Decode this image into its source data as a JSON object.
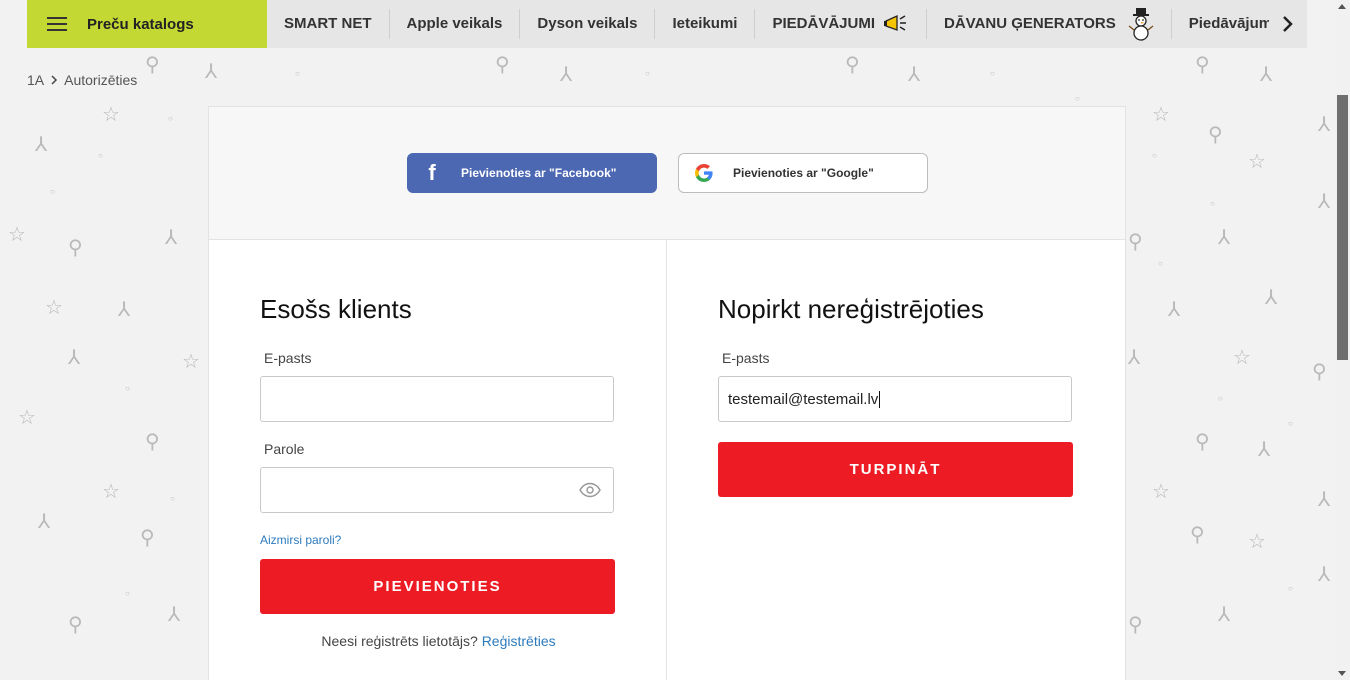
{
  "nav": {
    "catalog_label": "Preču katalogs",
    "items": [
      {
        "label": "SMART NET"
      },
      {
        "label": "Apple veikals"
      },
      {
        "label": "Dyson veikals"
      },
      {
        "label": "Ieteikumi"
      },
      {
        "label": "PIEDĀVĀJUMI"
      },
      {
        "label": "DĀVANU ĢENERATORS"
      },
      {
        "label": "Piedāvājums bi"
      }
    ]
  },
  "breadcrumb": {
    "home": "1A",
    "current": "Autorizēties"
  },
  "social": {
    "facebook_label": "Pievienoties ar \"Facebook\"",
    "google_label": "Pievienoties ar \"Google\"",
    "facebook_color": "#4c68b3"
  },
  "login": {
    "title": "Esošs klients",
    "email_label": "E-pasts",
    "email_value": "",
    "password_label": "Parole",
    "password_value": "",
    "forgot_link": "Aizmirsi paroli?",
    "submit_label": "PIEVIENOTIES",
    "register_prompt": "Neesi reģistrēts lietotājs?",
    "register_link": "Reģistrēties"
  },
  "guest": {
    "title": "Nopirkt nereģistrējoties",
    "email_label": "E-pasts",
    "email_value": "testemail@testemail.lv",
    "submit_label": "TURPINĀT"
  },
  "colors": {
    "accent_green": "#c3d833",
    "button_red": "#ed1c24",
    "link_blue": "#2d7bbd"
  }
}
